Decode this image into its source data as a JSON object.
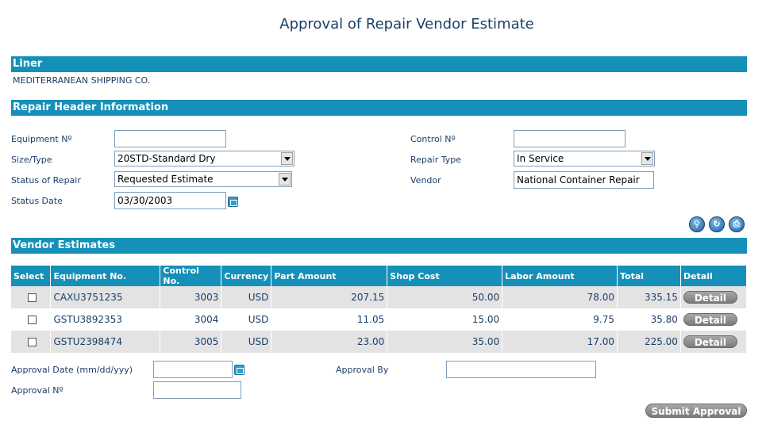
{
  "page": {
    "title": "Approval of Repair Vendor Estimate"
  },
  "liner": {
    "heading": "Liner",
    "value": "MEDITERRANEAN SHIPPING CO."
  },
  "header": {
    "heading": "Repair Header Information",
    "equipment_no_label": "Equipment Nº",
    "equipment_no_value": "",
    "size_type_label": "Size/Type",
    "size_type_value": "20STD-Standard Dry",
    "status_label": "Status of Repair",
    "status_value": "Requested Estimate",
    "status_date_label": "Status Date",
    "status_date_value": "03/30/2003",
    "control_no_label": "Control Nº",
    "control_no_value": "",
    "repair_type_label": "Repair Type",
    "repair_type_value": "In Service",
    "vendor_label": "Vendor",
    "vendor_value": "National Container Repair"
  },
  "toolbar": {
    "icons": [
      "search-icon",
      "refresh-icon",
      "print-icon"
    ]
  },
  "estimates": {
    "heading": "Vendor Estimates",
    "columns": [
      "Select",
      "Equipment No.",
      "Control No.",
      "Currency",
      "Part Amount",
      "Shop Cost",
      "Labor Amount",
      "Total",
      "Detail"
    ],
    "detail_label": "Detail",
    "rows": [
      {
        "equipment": "CAXU3751235",
        "control": "3003",
        "currency": "USD",
        "part": "207.15",
        "shop": "50.00",
        "labor": "78.00",
        "total": "335.15"
      },
      {
        "equipment": "GSTU3892353",
        "control": "3004",
        "currency": "USD",
        "part": "11.05",
        "shop": "15.00",
        "labor": "9.75",
        "total": "35.80"
      },
      {
        "equipment": "GSTU2398474",
        "control": "3005",
        "currency": "USD",
        "part": "23.00",
        "shop": "35.00",
        "labor": "17.00",
        "total": "225.00"
      }
    ]
  },
  "approval": {
    "date_label": "Approval Date (mm/dd/yyy)",
    "date_value": "",
    "by_label": "Approval By",
    "by_value": "",
    "no_label": "Approval Nº",
    "no_value": "",
    "submit_label": "Submit Approval"
  },
  "colors": {
    "band": "#1590b8",
    "text": "#1b3f6a",
    "row_alt": "#e3e3e3"
  }
}
